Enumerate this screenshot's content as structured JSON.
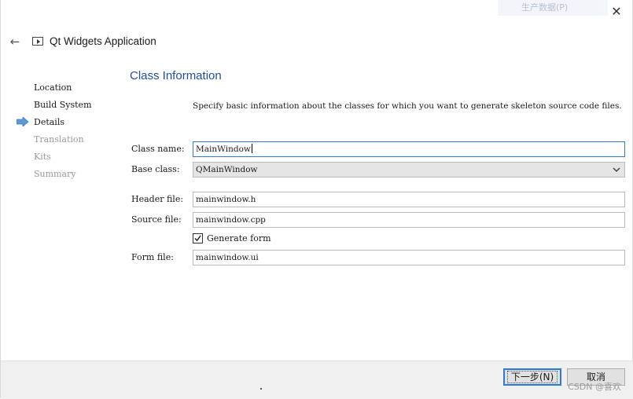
{
  "window": {
    "title": "Qt Widgets Application",
    "close_symbol": "✕",
    "back_symbol": "←",
    "overlay_text": "生产数据(P)"
  },
  "steps": [
    {
      "label": "Location",
      "state": "done"
    },
    {
      "label": "Build System",
      "state": "done"
    },
    {
      "label": "Details",
      "state": "current"
    },
    {
      "label": "Translation",
      "state": "pending"
    },
    {
      "label": "Kits",
      "state": "pending"
    },
    {
      "label": "Summary",
      "state": "pending"
    }
  ],
  "page": {
    "title": "Class Information",
    "description": "Specify basic information about the classes for which you want to generate skeleton source code files."
  },
  "form": {
    "class_name": {
      "label": "Class name:",
      "value": "MainWindow"
    },
    "base_class": {
      "label": "Base class:",
      "value": "QMainWindow"
    },
    "header_file": {
      "label": "Header file:",
      "value": "mainwindow.h"
    },
    "source_file": {
      "label": "Source file:",
      "value": "mainwindow.cpp"
    },
    "generate_form": {
      "label": "Generate form",
      "checked": true
    },
    "form_file": {
      "label": "Form file:",
      "value": "mainwindow.ui"
    }
  },
  "buttons": {
    "next": "下一步(N)",
    "cancel": "取消"
  },
  "watermark": "CSDN @喜欢",
  "colors": {
    "accent": "#2a7bd4",
    "title": "#1e4f9c",
    "inactive_step": "#9a9a9a",
    "arrow": "#5b9bd5"
  }
}
